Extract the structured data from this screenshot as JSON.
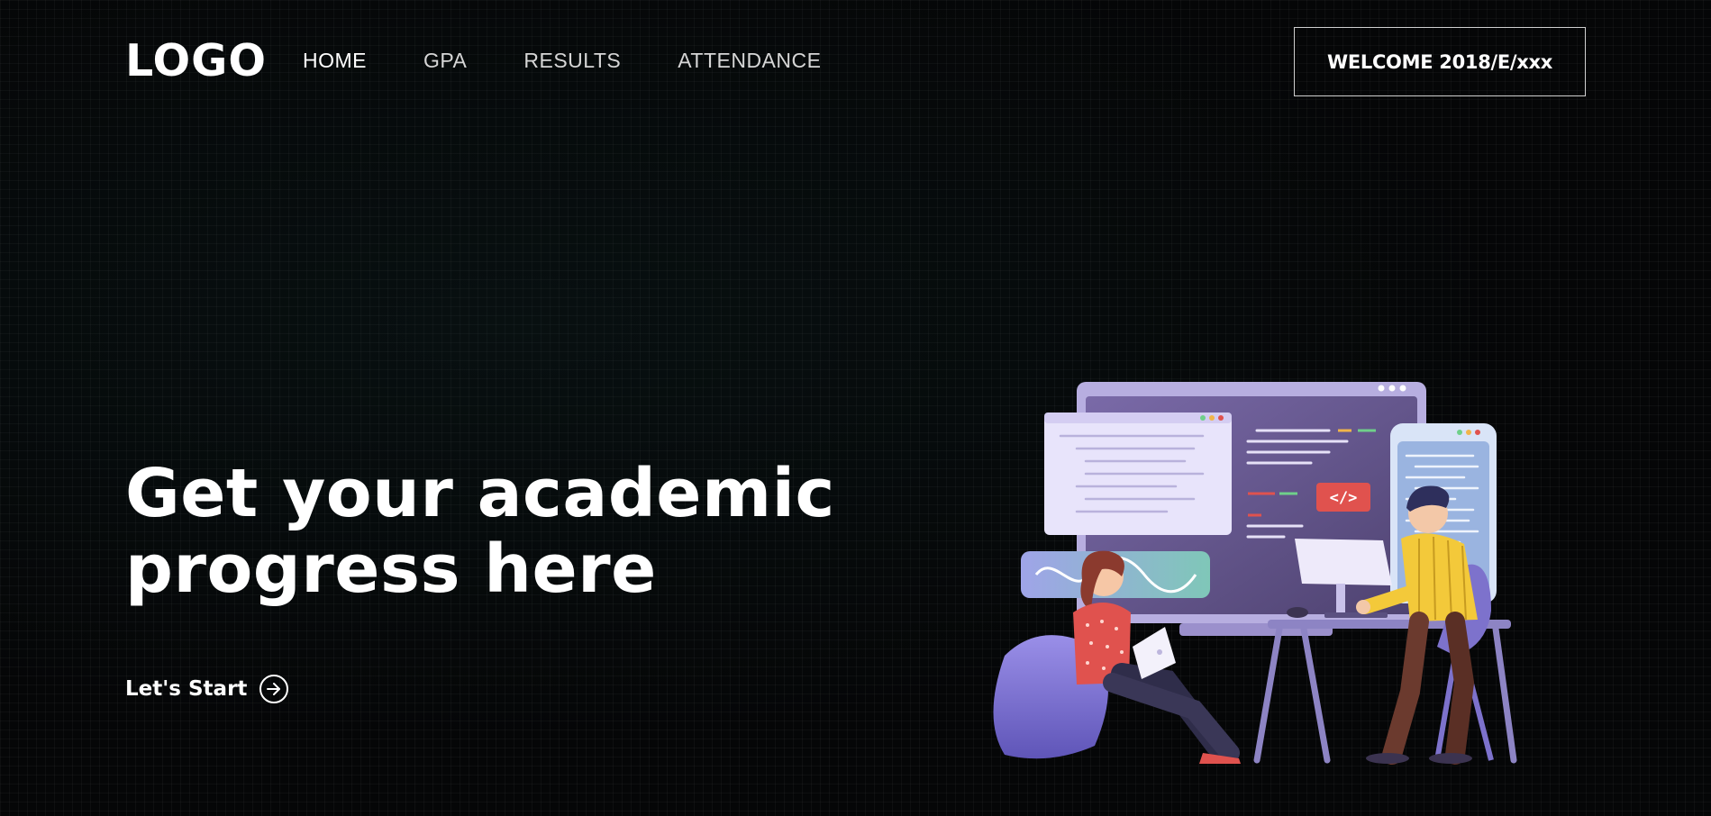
{
  "header": {
    "logo": "LOGO",
    "nav": [
      {
        "label": "HOME",
        "active": true
      },
      {
        "label": "GPA",
        "active": false
      },
      {
        "label": "RESULTS",
        "active": false
      },
      {
        "label": "ATTENDANCE",
        "active": false
      }
    ],
    "welcome_label": "WELCOME 2018/E/xxx"
  },
  "hero": {
    "title_line1": "Get your academic",
    "title_line2": "progress here",
    "cta_label": "Let's Start",
    "cta_icon": "arrow-right-circle-icon"
  },
  "illustration": {
    "code_badge": "</>"
  },
  "colors": {
    "background": "#050607",
    "text": "#ffffff",
    "accent_purple": "#8b7fd8",
    "accent_red": "#e0524e",
    "accent_yellow": "#f3c93a"
  }
}
